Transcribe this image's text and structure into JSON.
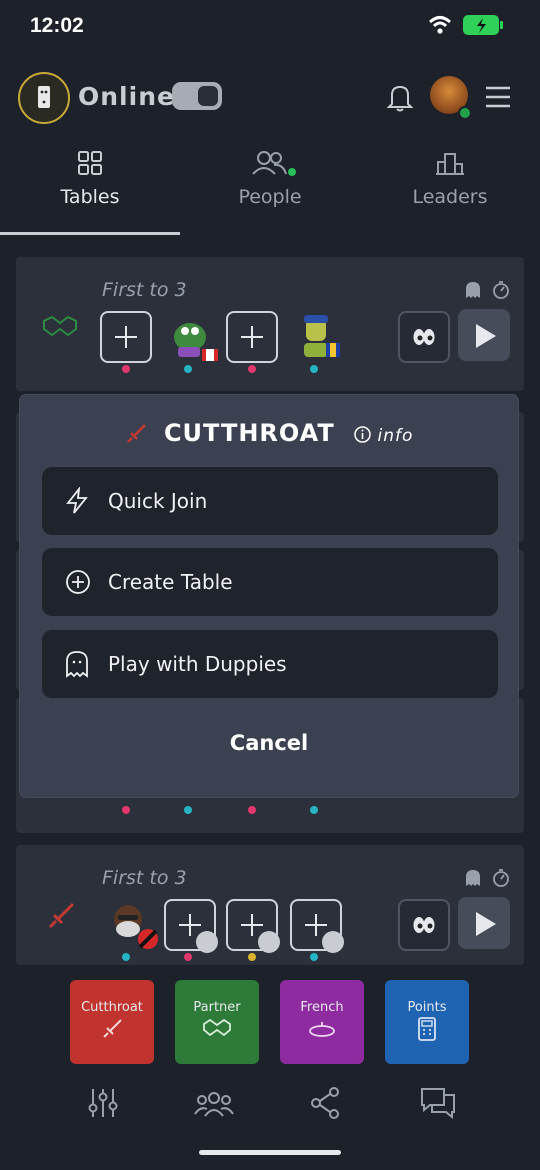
{
  "status_bar": {
    "time": "12:02"
  },
  "header": {
    "logo_alt": "SIX LOVE",
    "status_label": "Online",
    "toggle_on": true
  },
  "tabs": [
    {
      "label": "Tables",
      "active": true
    },
    {
      "label": "People",
      "has_dot": true
    },
    {
      "label": "Leaders"
    }
  ],
  "cards": [
    {
      "title": "First to 3",
      "mode": "partner"
    },
    {
      "title": "First to 3",
      "mode": "cutthroat"
    }
  ],
  "overlay": {
    "title": "CUTTHROAT",
    "info_label": "info",
    "buttons": [
      {
        "label": "Quick Join",
        "icon": "lightning-icon"
      },
      {
        "label": "Create Table",
        "icon": "plus-circle-icon"
      },
      {
        "label": "Play with Duppies",
        "icon": "ghost-icon"
      }
    ],
    "cancel_label": "Cancel"
  },
  "modes": [
    {
      "label": "Cutthroat",
      "color": "#c0332e"
    },
    {
      "label": "Partner",
      "color": "#2e7a38"
    },
    {
      "label": "French",
      "color": "#8e2ba1"
    },
    {
      "label": "Points",
      "color": "#1f63b3"
    }
  ],
  "colors": {
    "background": "#1d2129",
    "card": "#2b303b",
    "overlay": "#3b4150",
    "online_green": "#23a04b"
  }
}
